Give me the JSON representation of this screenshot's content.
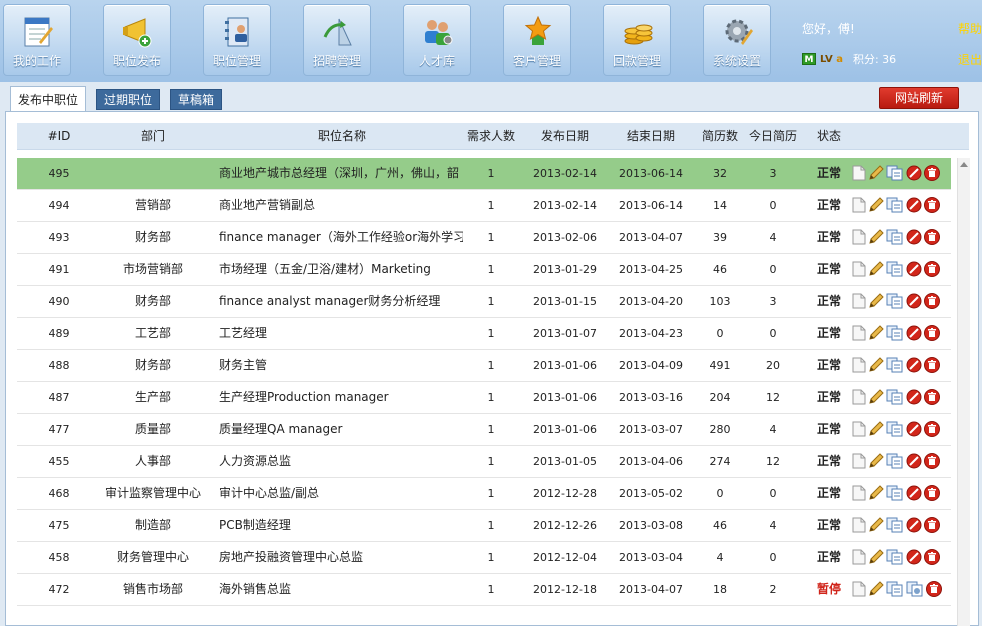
{
  "toolbar": [
    {
      "label": "我的工作",
      "icon": "my-work-icon"
    },
    {
      "label": "职位发布",
      "icon": "publish-job-icon"
    },
    {
      "label": "职位管理",
      "icon": "job-manage-icon"
    },
    {
      "label": "招聘管理",
      "icon": "recruit-manage-icon"
    },
    {
      "label": "人才库",
      "icon": "talent-pool-icon"
    },
    {
      "label": "客户管理",
      "icon": "customer-manage-icon"
    },
    {
      "label": "回款管理",
      "icon": "payment-manage-icon"
    },
    {
      "label": "系统设置",
      "icon": "settings-icon"
    }
  ],
  "user": {
    "greeting": "您好，傅!",
    "help": "帮助",
    "logout": "退出",
    "badge_m": "M",
    "level_prefix": "LV",
    "level": "a",
    "score": "积分: 36"
  },
  "tabs": {
    "active": "发布中职位",
    "expired": "过期职位",
    "draft": "草稿箱",
    "refresh": "网站刷新"
  },
  "columns": {
    "id": "#ID",
    "dept": "部门",
    "title": "职位名称",
    "headcount": "需求人数",
    "start": "发布日期",
    "end": "结束日期",
    "resumes": "简历数",
    "today": "今日简历",
    "status": "状态"
  },
  "rows": [
    {
      "id": "495",
      "dept": "",
      "title": "商业地产城市总经理（深圳，广州，佛山，韶",
      "count": "1",
      "start": "2013-02-14",
      "end": "2013-06-14",
      "resumes": "32",
      "today": "3",
      "status": "正常",
      "highlight": true
    },
    {
      "id": "494",
      "dept": "营销部",
      "title": "商业地产营销副总",
      "count": "1",
      "start": "2013-02-14",
      "end": "2013-06-14",
      "resumes": "14",
      "today": "0",
      "status": "正常"
    },
    {
      "id": "493",
      "dept": "财务部",
      "title": "finance manager（海外工作经验or海外学习",
      "count": "1",
      "start": "2013-02-06",
      "end": "2013-04-07",
      "resumes": "39",
      "today": "4",
      "status": "正常"
    },
    {
      "id": "491",
      "dept": "市场营销部",
      "title": "市场经理（五金/卫浴/建材）Marketing",
      "count": "1",
      "start": "2013-01-29",
      "end": "2013-04-25",
      "resumes": "46",
      "today": "0",
      "status": "正常"
    },
    {
      "id": "490",
      "dept": "财务部",
      "title": "finance analyst manager财务分析经理",
      "count": "1",
      "start": "2013-01-15",
      "end": "2013-04-20",
      "resumes": "103",
      "today": "3",
      "status": "正常"
    },
    {
      "id": "489",
      "dept": "工艺部",
      "title": "工艺经理",
      "count": "1",
      "start": "2013-01-07",
      "end": "2013-04-23",
      "resumes": "0",
      "today": "0",
      "status": "正常"
    },
    {
      "id": "488",
      "dept": "财务部",
      "title": "财务主管",
      "count": "1",
      "start": "2013-01-06",
      "end": "2013-04-09",
      "resumes": "491",
      "today": "20",
      "status": "正常"
    },
    {
      "id": "487",
      "dept": "生产部",
      "title": "生产经理Production manager",
      "count": "1",
      "start": "2013-01-06",
      "end": "2013-03-16",
      "resumes": "204",
      "today": "12",
      "status": "正常"
    },
    {
      "id": "477",
      "dept": "质量部",
      "title": "质量经理QA manager",
      "count": "1",
      "start": "2013-01-06",
      "end": "2013-03-07",
      "resumes": "280",
      "today": "4",
      "status": "正常"
    },
    {
      "id": "455",
      "dept": "人事部",
      "title": "人力资源总监",
      "count": "1",
      "start": "2013-01-05",
      "end": "2013-04-06",
      "resumes": "274",
      "today": "12",
      "status": "正常"
    },
    {
      "id": "468",
      "dept": "审计监察管理中心",
      "title": "审计中心总监/副总",
      "count": "1",
      "start": "2012-12-28",
      "end": "2013-05-02",
      "resumes": "0",
      "today": "0",
      "status": "正常"
    },
    {
      "id": "475",
      "dept": "制造部",
      "title": "PCB制造经理",
      "count": "1",
      "start": "2012-12-26",
      "end": "2013-03-08",
      "resumes": "46",
      "today": "4",
      "status": "正常"
    },
    {
      "id": "458",
      "dept": "财务管理中心",
      "title": "房地产投融资管理中心总监",
      "count": "1",
      "start": "2012-12-04",
      "end": "2013-03-04",
      "resumes": "4",
      "today": "0",
      "status": "正常"
    },
    {
      "id": "472",
      "dept": "销售市场部",
      "title": "海外销售总监",
      "count": "1",
      "start": "2012-12-18",
      "end": "2013-04-07",
      "resumes": "18",
      "today": "2",
      "status": "暂停",
      "paused": true
    }
  ],
  "colors": {
    "highlight_row": "#95cc8a",
    "paused_status": "#d0241a",
    "refresh_button": "#c8261a",
    "header_bg": "#dbe7f3"
  }
}
